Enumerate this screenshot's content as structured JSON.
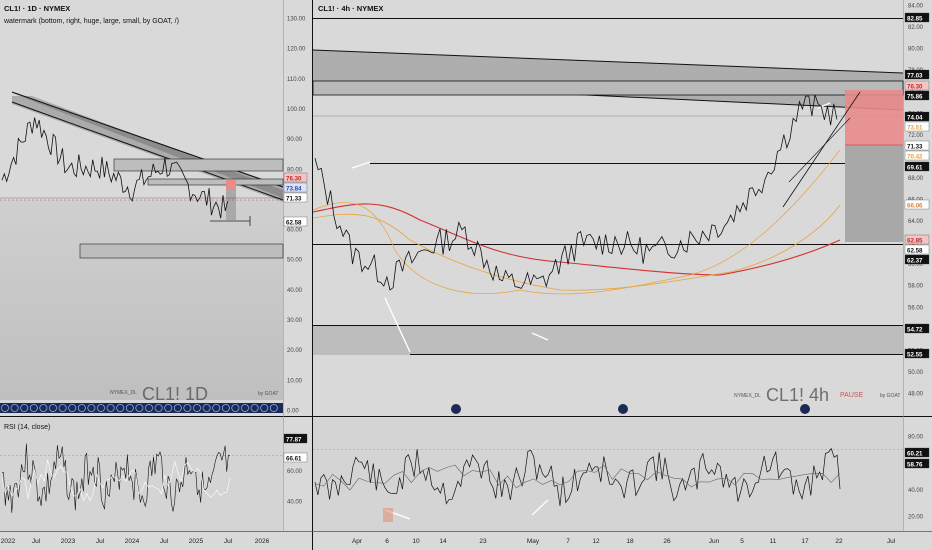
{
  "left": {
    "title": "CL1! · 1D · NYMEX",
    "subtitle": "watermark (bottom, right, huge, large, small, by GOAT, /)",
    "watermark_small": "NYMEX_DL",
    "watermark_big": "CL1! 1D",
    "watermark_by": "by GOAT",
    "price_ticks": [
      "130.00",
      "120.00",
      "110.00",
      "100.00",
      "90.00",
      "80.00",
      "70.00",
      "60.00",
      "50.00",
      "40.00",
      "30.00",
      "20.00",
      "10.00",
      "0.00"
    ],
    "price_badges": [
      {
        "text": "76.30",
        "bg": "#f2c6c6",
        "fg": "#c62828"
      },
      {
        "text": "73.84",
        "bg": "#dde3f5",
        "fg": "#2e4aa8"
      },
      {
        "text": "71.33",
        "bg": "#ffffff",
        "fg": "#111111"
      },
      {
        "text": "62.58",
        "bg": "#ffffff",
        "fg": "#111111"
      }
    ],
    "date_ticks": [
      "2022",
      "Jul",
      "2023",
      "Jul",
      "2024",
      "Jul",
      "2025",
      "Jul",
      "2026"
    ],
    "rsi_title": "RSI (14, close)",
    "rsi_ticks": [
      "80.00",
      "60.00",
      "40.00"
    ],
    "rsi_badges": [
      {
        "text": "77.87",
        "bg": "#111111",
        "fg": "#ffffff"
      },
      {
        "text": "66.61",
        "bg": "#ffffff",
        "fg": "#111111"
      }
    ]
  },
  "right": {
    "title": "CL1! · 4h · NYMEX",
    "watermark_small": "NYMEX_DL",
    "watermark_big": "CL1! 4h",
    "watermark_red": "PAUSE",
    "watermark_by": "by GOAT",
    "price_ticks": [
      "84.00",
      "82.00",
      "80.00",
      "78.00",
      "76.00",
      "74.00",
      "72.00",
      "70.00",
      "68.00",
      "66.00",
      "64.00",
      "62.00",
      "60.00",
      "58.00",
      "56.00",
      "54.00",
      "52.00",
      "50.00",
      "48.00"
    ],
    "price_badges": [
      {
        "text": "82.85",
        "bg": "#111111",
        "fg": "#ffffff"
      },
      {
        "text": "77.03",
        "bg": "#111111",
        "fg": "#ffffff"
      },
      {
        "text": "76.30",
        "bg": "#f2c6c6",
        "fg": "#c62828"
      },
      {
        "text": "75.86",
        "bg": "#111111",
        "fg": "#ffffff"
      },
      {
        "text": "74.04",
        "bg": "#111111",
        "fg": "#ffffff"
      },
      {
        "text": "73.51",
        "bg": "#ffffff",
        "fg": "#e8a33c"
      },
      {
        "text": "71.33",
        "bg": "#ffffff",
        "fg": "#111111"
      },
      {
        "text": "70.42",
        "bg": "#ffffff",
        "fg": "#e8a33c"
      },
      {
        "text": "69.61",
        "bg": "#111111",
        "fg": "#ffffff"
      },
      {
        "text": "66.06",
        "bg": "#ffffff",
        "fg": "#e57c2e"
      },
      {
        "text": "62.85",
        "bg": "#f2c6c6",
        "fg": "#c62828"
      },
      {
        "text": "62.58",
        "bg": "#ffffff",
        "fg": "#111111"
      },
      {
        "text": "62.37",
        "bg": "#111111",
        "fg": "#ffffff"
      },
      {
        "text": "54.72",
        "bg": "#111111",
        "fg": "#ffffff"
      },
      {
        "text": "52.55",
        "bg": "#111111",
        "fg": "#ffffff"
      }
    ],
    "date_ticks": [
      "Apr",
      "6",
      "10",
      "14",
      "23",
      "May",
      "7",
      "12",
      "18",
      "26",
      "Jun",
      "5",
      "11",
      "17",
      "22",
      "Jul"
    ],
    "rsi_ticks": [
      "80.00",
      "60.00",
      "40.00",
      "20.00"
    ],
    "rsi_badges": [
      {
        "text": "60.21",
        "bg": "#111111",
        "fg": "#ffffff"
      },
      {
        "text": "58.76",
        "bg": "#111111",
        "fg": "#ffffff"
      }
    ]
  },
  "colors": {
    "background": "#d9d9d9",
    "line": "#111111",
    "ma_short": "#e8a33c",
    "ma_long": "#d62f2f",
    "red_zone": "#e88b8b",
    "divergence": "#ffffff"
  },
  "chart_data": [
    {
      "type": "line",
      "title": "CL1! · 1D · NYMEX",
      "x": [
        "2022",
        "Jul",
        "2023",
        "Jul",
        "2024",
        "Jul",
        "2025",
        "Jul",
        "2026"
      ],
      "ylim": [
        0,
        130
      ],
      "series": [],
      "close_points": [
        [
          "2022",
          76.3
        ],
        [
          "Jul",
          97.0
        ],
        [
          "2023",
          80.3
        ],
        [
          "Jul",
          80.6
        ],
        [
          "2024",
          73.4
        ],
        [
          "Jul",
          81.5
        ],
        [
          "2025",
          71.7
        ],
        [
          "Jul",
          65.5
        ]
      ],
      "levels": [
        82.85,
        77.03,
        76.3,
        73.84,
        71.33,
        62.58,
        54.72,
        52.55
      ],
      "grid": false
    },
    {
      "type": "line",
      "title": "CL1! · 4h · NYMEX",
      "x": [
        "Apr",
        "6",
        "10",
        "14",
        "23",
        "May",
        "7",
        "12",
        "18",
        "26",
        "Jun",
        "5",
        "11",
        "17",
        "22",
        "Jul"
      ],
      "ylim": [
        48,
        84
      ],
      "series": [],
      "close_points": [
        [
          "Apr",
          69.2
        ],
        [
          "6",
          61.0
        ],
        [
          "10",
          58.6
        ],
        [
          "14",
          61.5
        ],
        [
          "23",
          63.0
        ],
        [
          "May",
          58.3
        ],
        [
          "7",
          58.1
        ],
        [
          "12",
          61.8
        ],
        [
          "18",
          62.1
        ],
        [
          "26",
          61.0
        ],
        [
          "Jun",
          62.3
        ],
        [
          "5",
          64.0
        ],
        [
          "11",
          68.1
        ],
        [
          "17",
          74.8
        ],
        [
          "22",
          73.8
        ]
      ],
      "levels": [
        82.85,
        77.03,
        76.3,
        75.86,
        74.04,
        73.51,
        71.33,
        70.42,
        69.61,
        66.06,
        62.85,
        62.58,
        62.37,
        54.72,
        52.55
      ],
      "grid": false
    }
  ]
}
